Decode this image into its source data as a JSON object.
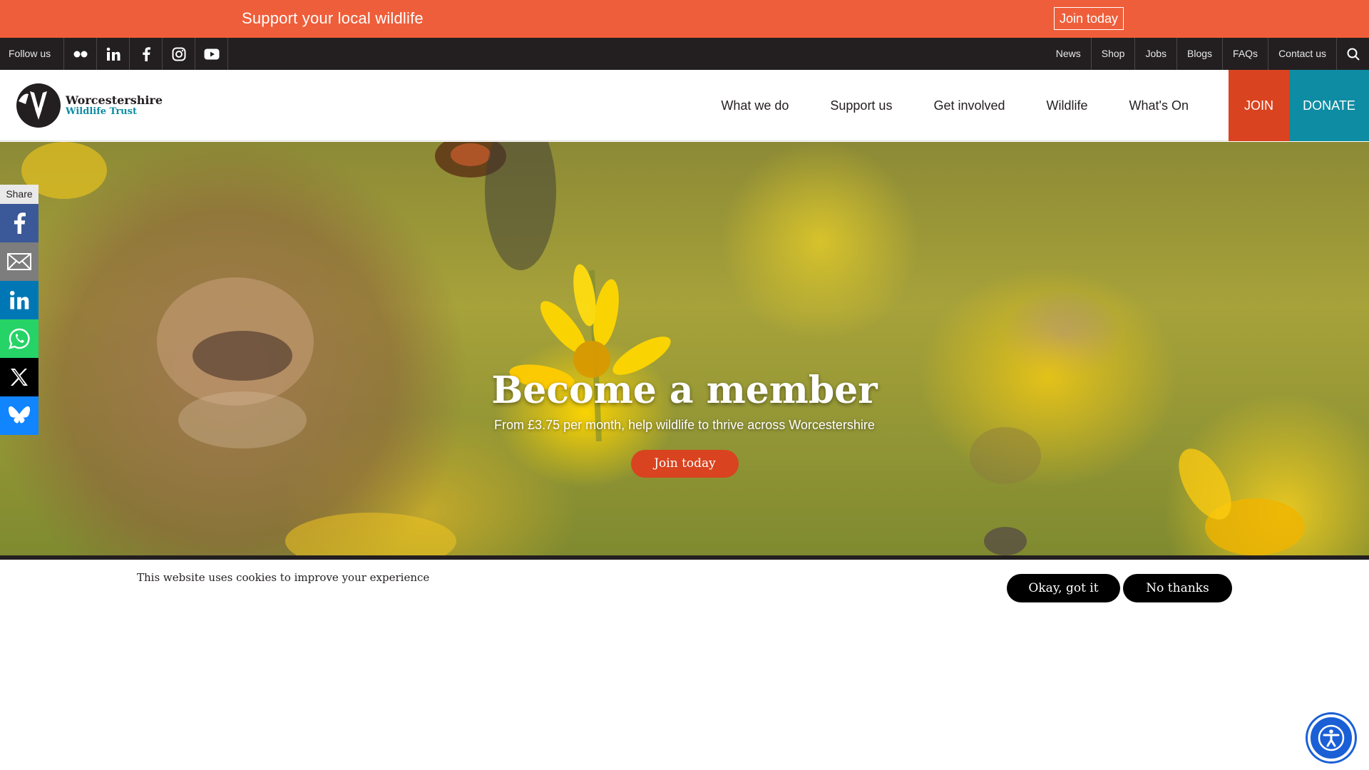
{
  "promo": {
    "text": "Support your local wildlife",
    "button": "Join today"
  },
  "utility": {
    "follow_label": "Follow us",
    "social_icons": [
      "flickr-icon",
      "linkedin-icon",
      "facebook-icon",
      "instagram-icon",
      "youtube-icon"
    ],
    "links": [
      "News",
      "Shop",
      "Jobs",
      "Blogs",
      "FAQs",
      "Contact us"
    ]
  },
  "header": {
    "logo_line1": "Worcestershire",
    "logo_line2": "Wildlife Trust",
    "nav": [
      "What we do",
      "Support us",
      "Get involved",
      "Wildlife",
      "What's On"
    ],
    "join": "JOIN",
    "donate": "DONATE"
  },
  "hero": {
    "title": "Become a member",
    "subtitle": "From £3.75 per month, help wildlife to thrive across Worcestershire",
    "button": "Join today"
  },
  "share": {
    "label": "Share",
    "buttons": [
      "facebook-icon",
      "email-icon",
      "linkedin-icon",
      "whatsapp-icon",
      "x-icon",
      "bluesky-icon"
    ]
  },
  "cookie": {
    "text": "This website uses cookies to improve your experience",
    "accept": "Okay, got it",
    "decline": "No thanks"
  },
  "colors": {
    "promo": "#ef5e3a",
    "utility_bar": "#231f20",
    "join": "#d9431f",
    "donate": "#0e8ca3",
    "accessibility": "#1a5fd6"
  }
}
